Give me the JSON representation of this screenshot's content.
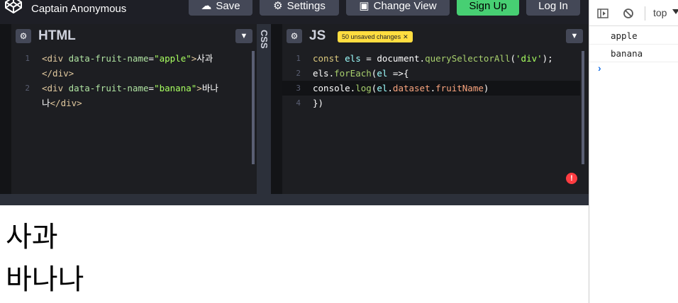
{
  "header": {
    "user_name": "Captain Anonymous",
    "buttons": {
      "save": "Save",
      "settings": "Settings",
      "change_view": "Change View",
      "sign_up": "Sign Up",
      "log_in": "Log In"
    },
    "colors": {
      "signup_bg": "#47cf73",
      "button_bg": "#444857"
    }
  },
  "html_pane": {
    "title": "HTML",
    "lines": [
      {
        "num": "1",
        "parts": [
          {
            "cls": "t-tag",
            "text": "<div "
          },
          {
            "cls": "t-attr",
            "text": "data-fruit-name"
          },
          {
            "cls": "t-plain",
            "text": "="
          },
          {
            "cls": "t-str",
            "text": "\"apple\""
          },
          {
            "cls": "t-tag",
            "text": ">"
          },
          {
            "cls": "t-plain",
            "text": "사과"
          }
        ]
      },
      {
        "num": "",
        "parts": [
          {
            "cls": "t-tag",
            "text": "</div>"
          }
        ]
      },
      {
        "num": "2",
        "parts": [
          {
            "cls": "t-tag",
            "text": "<div "
          },
          {
            "cls": "t-attr",
            "text": "data-fruit-name"
          },
          {
            "cls": "t-plain",
            "text": "="
          },
          {
            "cls": "t-str",
            "text": "\"banana\""
          },
          {
            "cls": "t-tag",
            "text": ">"
          },
          {
            "cls": "t-plain",
            "text": "바나"
          }
        ]
      },
      {
        "num": "",
        "parts": [
          {
            "cls": "t-plain",
            "text": "나"
          },
          {
            "cls": "t-tag",
            "text": "</div>"
          }
        ]
      }
    ]
  },
  "css_pane": {
    "title": "CSS"
  },
  "js_pane": {
    "title": "JS",
    "badge": "50 unsaved changes",
    "lines": [
      {
        "num": "1",
        "parts": [
          {
            "cls": "t-kw",
            "text": "const "
          },
          {
            "cls": "t-var",
            "text": "els "
          },
          {
            "cls": "t-plain",
            "text": "= document."
          },
          {
            "cls": "t-fn",
            "text": "querySelectorAll"
          },
          {
            "cls": "t-plain",
            "text": "("
          },
          {
            "cls": "t-str",
            "text": "'div'"
          },
          {
            "cls": "t-plain",
            "text": ");"
          }
        ]
      },
      {
        "num": "2",
        "parts": [
          {
            "cls": "t-plain",
            "text": "els."
          },
          {
            "cls": "t-fn",
            "text": "forEach"
          },
          {
            "cls": "t-plain",
            "text": "("
          },
          {
            "cls": "t-var",
            "text": "el "
          },
          {
            "cls": "t-plain",
            "text": "=>{"
          }
        ]
      },
      {
        "num": "3",
        "parts": [
          {
            "cls": "t-plain",
            "text": "  console."
          },
          {
            "cls": "t-fn",
            "text": "log"
          },
          {
            "cls": "t-plain",
            "text": "("
          },
          {
            "cls": "t-var",
            "text": "el"
          },
          {
            "cls": "t-plain",
            "text": "."
          },
          {
            "cls": "t-prop",
            "text": "dataset"
          },
          {
            "cls": "t-plain",
            "text": "."
          },
          {
            "cls": "t-prop",
            "text": "fruitName"
          },
          {
            "cls": "t-plain",
            "text": ")"
          }
        ]
      },
      {
        "num": "4",
        "parts": [
          {
            "cls": "t-plain",
            "text": "})"
          }
        ]
      }
    ],
    "error_icon": "!"
  },
  "preview": {
    "items": [
      "사과",
      "바나나"
    ]
  },
  "console": {
    "context": "top",
    "logs": [
      "apple",
      "banana"
    ],
    "prompt": "›"
  }
}
